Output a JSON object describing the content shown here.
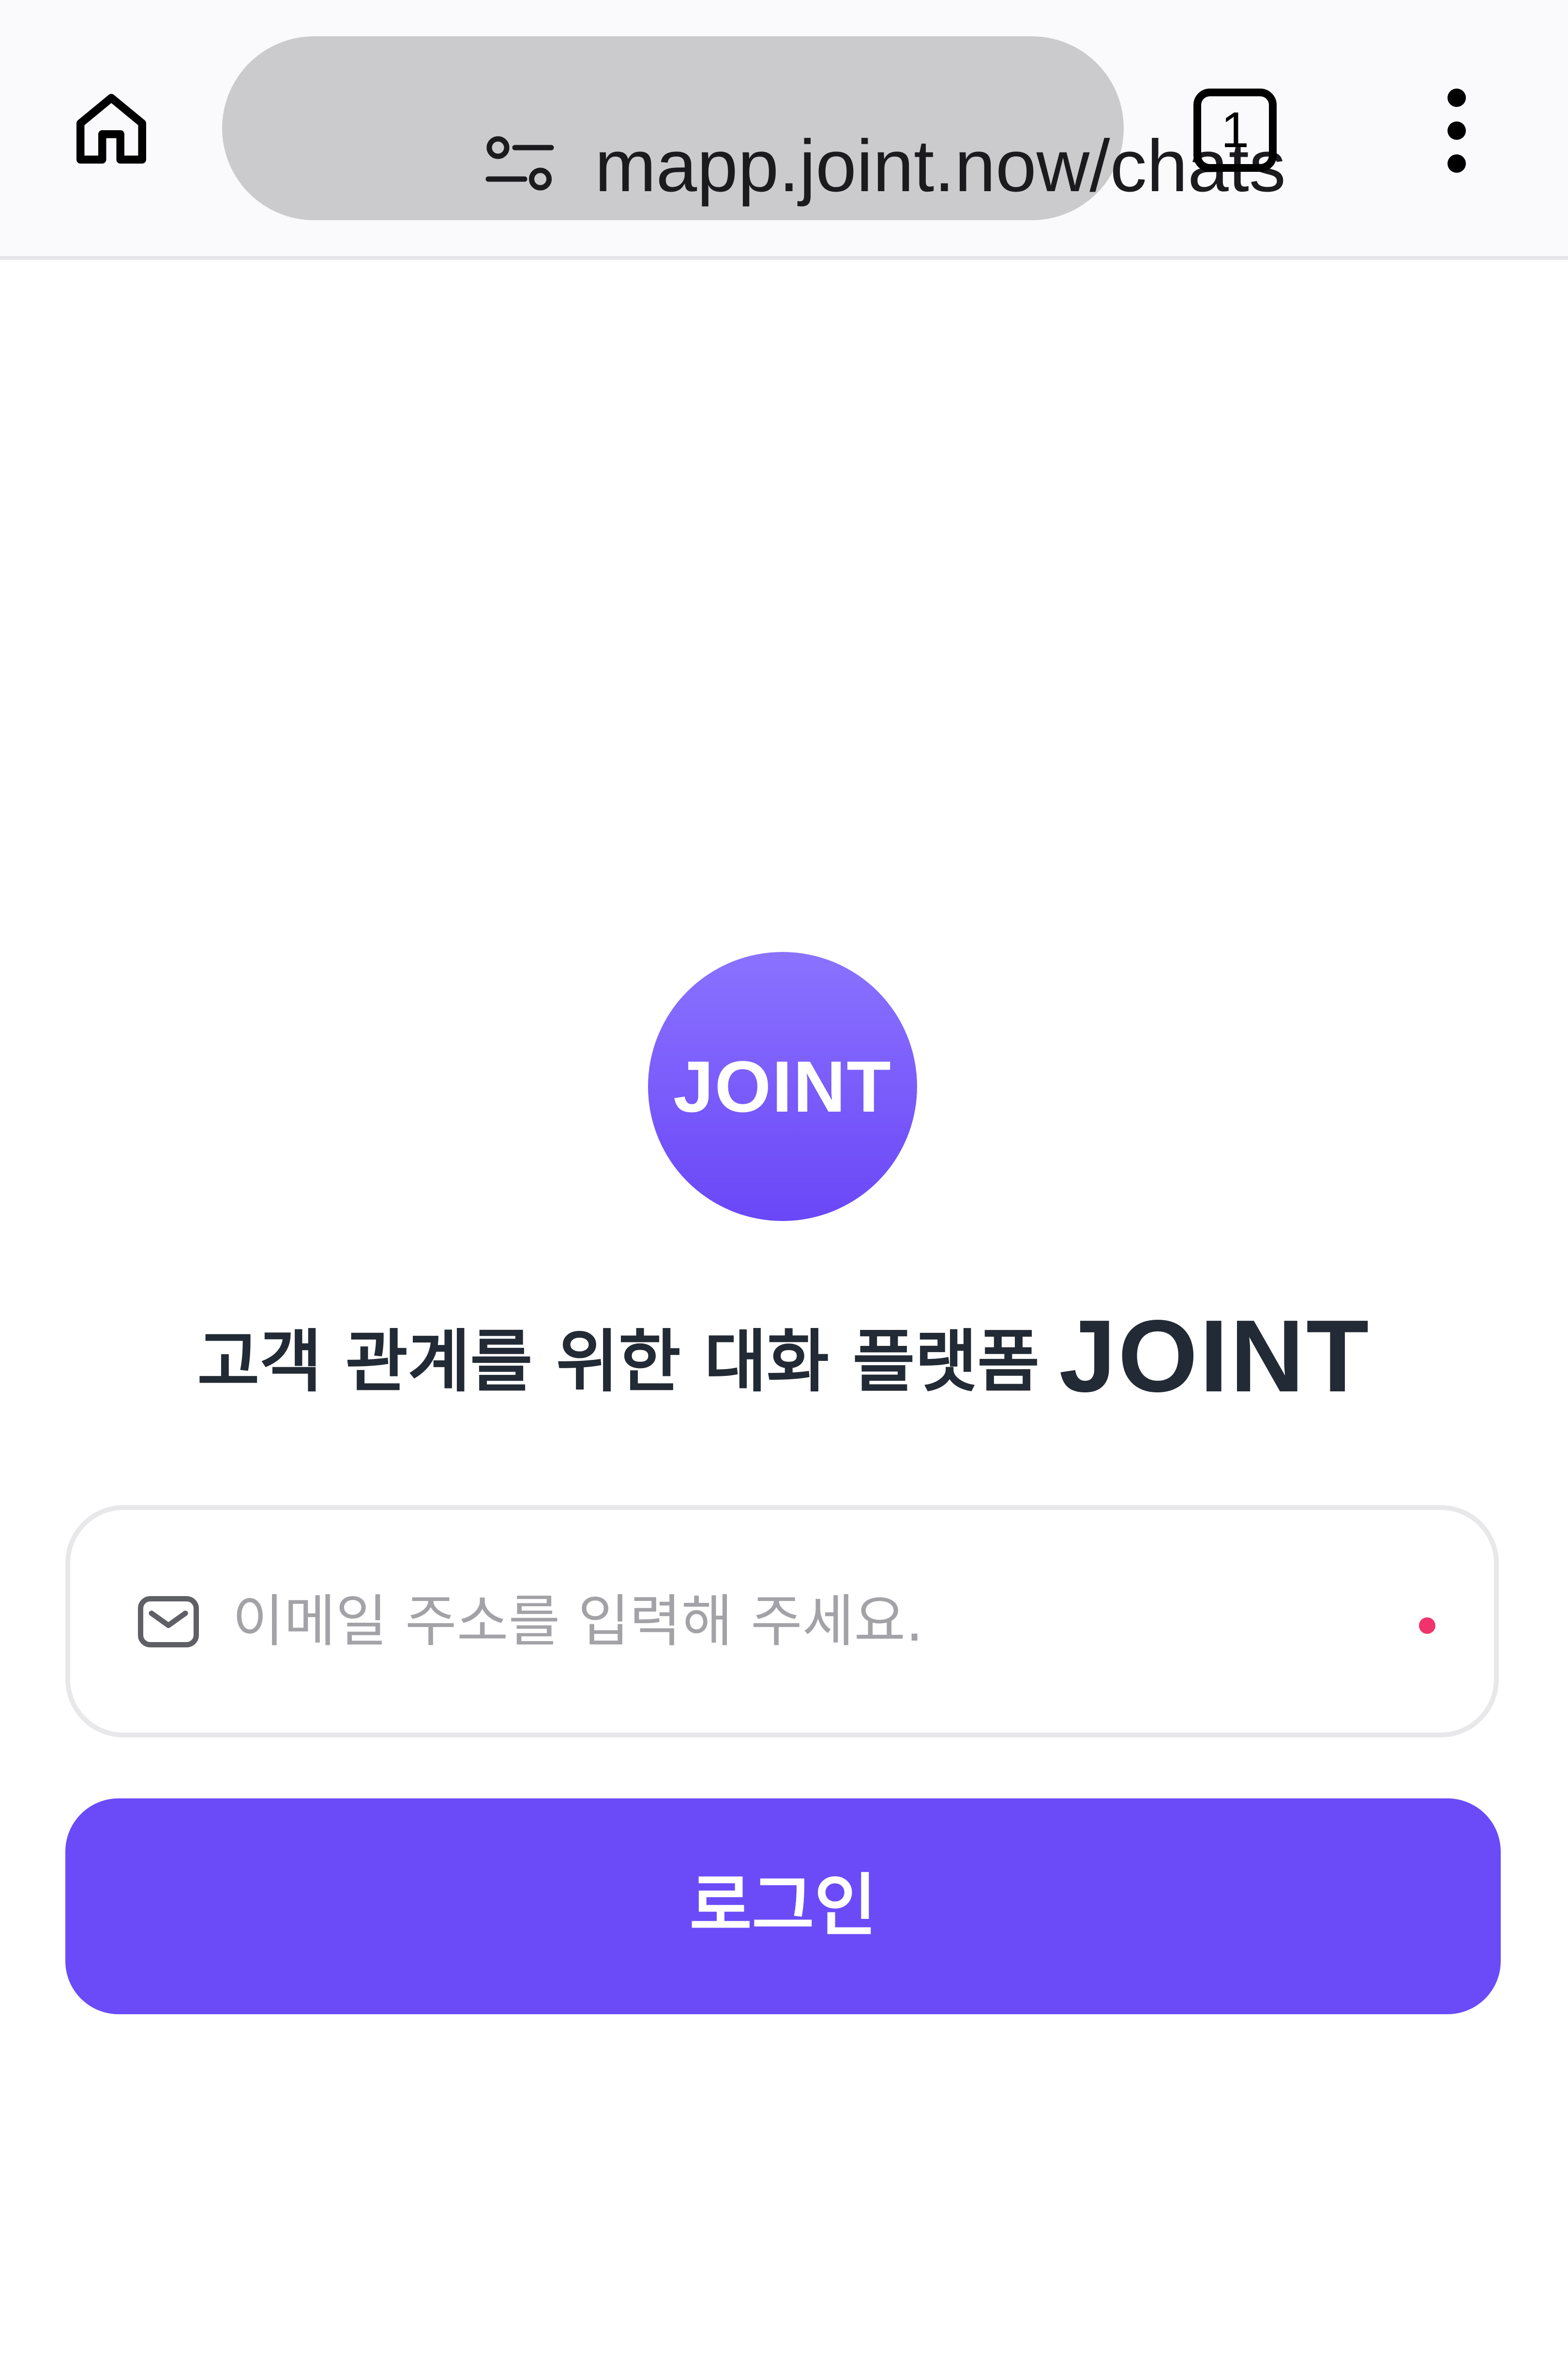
{
  "browser": {
    "url": "mapp.joint.now/chats",
    "tab_count": "1",
    "icons": {
      "home": "home-icon",
      "site_settings": "site-settings-icon",
      "tabs": "tab-switcher-icon",
      "menu": "more-vert-icon"
    }
  },
  "app": {
    "logo_text": "JOINT",
    "headline_sub": "고객 관계를 위한 대화 플랫폼",
    "headline_brand": "JOINT",
    "email_field": {
      "value": "",
      "placeholder": "이메일 주소를 입력해 주세요.",
      "icon": "mail-icon",
      "required": true
    },
    "login_button_label": "로그인"
  },
  "colors": {
    "accent": "#6b4bf8",
    "logo_gradient_top": "#8b72ff",
    "logo_gradient_bottom": "#6a47f7",
    "headline_text": "#222a35",
    "required_dot": "#f0336c",
    "url_pill_bg": "#cbcbcd",
    "toolbar_bg": "#fafafc"
  }
}
